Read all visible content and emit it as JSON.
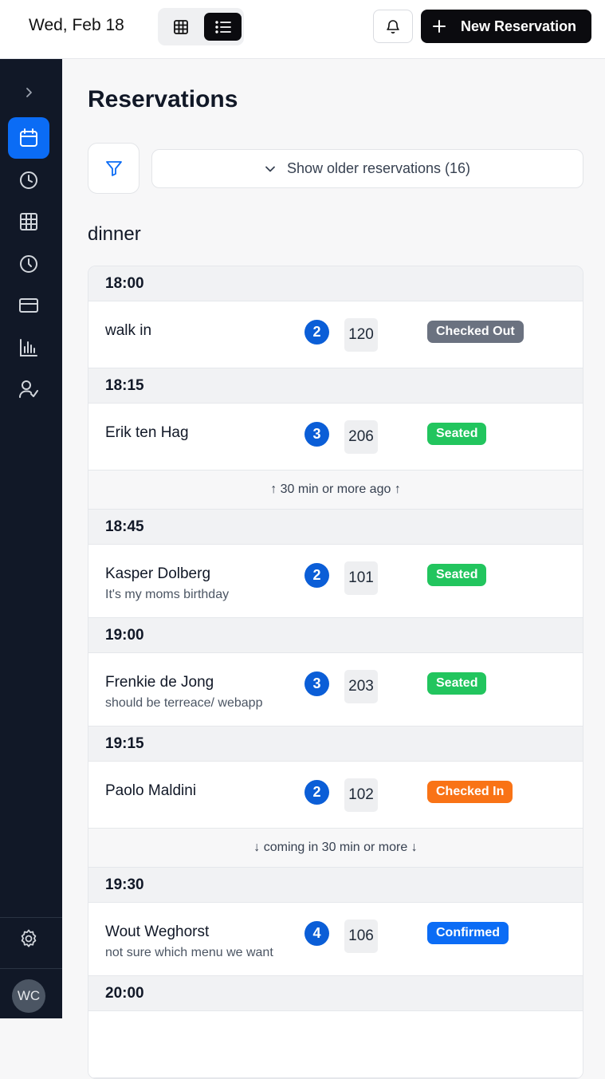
{
  "header": {
    "date": "Wed, Feb 18",
    "new_reservation_label": "New Reservation"
  },
  "sidebar": {
    "items": [
      {
        "name": "sidebar-expand",
        "icon": "chevron-right-icon"
      },
      {
        "name": "sidebar-item-calendar",
        "icon": "calendar-icon",
        "active": true
      },
      {
        "name": "sidebar-item-history",
        "icon": "clock-history-icon"
      },
      {
        "name": "sidebar-item-tables",
        "icon": "table-grid-icon"
      },
      {
        "name": "sidebar-item-schedule",
        "icon": "clock-icon"
      },
      {
        "name": "sidebar-item-payments",
        "icon": "credit-card-icon"
      },
      {
        "name": "sidebar-item-reports",
        "icon": "bar-chart-icon"
      },
      {
        "name": "sidebar-item-guests",
        "icon": "user-check-icon"
      }
    ],
    "settings_icon": "gear-icon",
    "avatar_initials": "WC",
    "accent": "#0b6cf5"
  },
  "main": {
    "title": "Reservations",
    "older_label": "Show older reservations (16)",
    "section": "dinner",
    "past_divider": "↑ 30 min or more ago ↑",
    "future_divider": "↓ coming in 30 min or more ↓",
    "groups": [
      {
        "time": "18:00",
        "reservations": [
          {
            "name": "walk in",
            "note": "",
            "party": "2",
            "table": "120",
            "status": "Checked Out",
            "status_color": "#6b7280"
          }
        ]
      },
      {
        "time": "18:15",
        "reservations": [
          {
            "name": "Erik ten Hag",
            "note": "",
            "party": "3",
            "table": "206",
            "status": "Seated",
            "status_color": "#22c55e"
          }
        ]
      },
      {
        "time": "18:45",
        "reservations": [
          {
            "name": "Kasper Dolberg",
            "note": "It's my moms birthday",
            "party": "2",
            "table": "101",
            "status": "Seated",
            "status_color": "#22c55e"
          }
        ]
      },
      {
        "time": "19:00",
        "reservations": [
          {
            "name": "Frenkie de Jong",
            "note": "should be terreace/ webapp",
            "party": "3",
            "table": "203",
            "status": "Seated",
            "status_color": "#22c55e"
          }
        ]
      },
      {
        "time": "19:15",
        "reservations": [
          {
            "name": "Paolo Maldini",
            "note": "",
            "party": "2",
            "table": "102",
            "status": "Checked In",
            "status_color": "#f97316"
          }
        ]
      },
      {
        "time": "19:30",
        "reservations": [
          {
            "name": "Wout Weghorst",
            "note": "not sure which menu we want",
            "party": "4",
            "table": "106",
            "status": "Confirmed",
            "status_color": "#0b6cf5"
          }
        ]
      },
      {
        "time": "20:00",
        "reservations": []
      }
    ]
  }
}
